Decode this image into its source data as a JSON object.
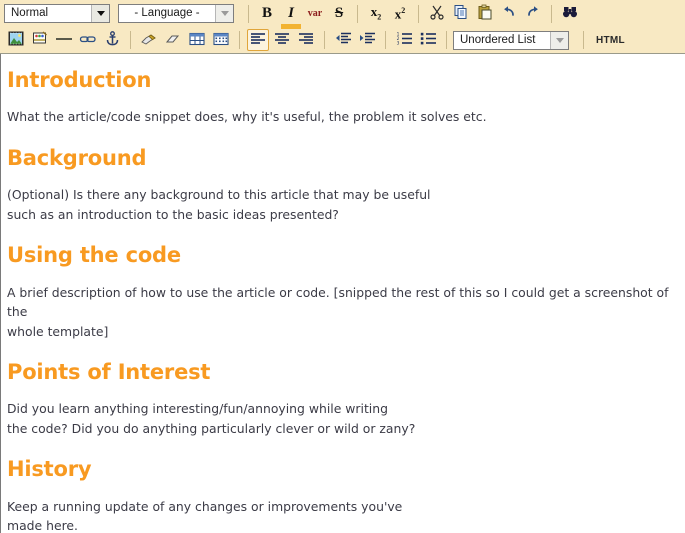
{
  "toolbar": {
    "row1": {
      "format_select": {
        "name": "paragraph-format-select",
        "value": "Normal",
        "enabled": true
      },
      "language_select": {
        "name": "language-select",
        "value": "- Language -",
        "enabled": false
      },
      "buttons": [
        {
          "name": "bold-button",
          "label": "B",
          "style": "lbl-b",
          "active": false
        },
        {
          "name": "italic-button",
          "label": "I",
          "style": "lbl-i",
          "active": true
        },
        {
          "name": "variable-button",
          "label": "var",
          "style": "lbl-var",
          "active": false
        },
        {
          "name": "strikethrough-button",
          "label": "S",
          "style": "lbl-s",
          "active": false
        }
      ],
      "script_buttons": [
        {
          "name": "subscript-button",
          "label": "x",
          "script": "2"
        },
        {
          "name": "superscript-button",
          "label": "x",
          "script": "2"
        }
      ],
      "clipboard_buttons": [
        {
          "name": "cut-icon",
          "label": "Cut"
        },
        {
          "name": "copy-icon",
          "label": "Copy"
        },
        {
          "name": "paste-icon",
          "label": "Paste"
        },
        {
          "name": "undo-icon",
          "label": "Undo"
        },
        {
          "name": "redo-icon",
          "label": "Redo"
        }
      ],
      "find_button": {
        "name": "find-icon",
        "label": "Find"
      }
    },
    "row2": {
      "insert_buttons": [
        {
          "name": "image-icon",
          "label": "Image"
        },
        {
          "name": "flash-icon",
          "label": "Flash"
        },
        {
          "name": "horizontal-rule-icon",
          "label": "Horizontal Rule"
        },
        {
          "name": "link-icon",
          "label": "Link"
        },
        {
          "name": "anchor-icon",
          "label": "Anchor"
        }
      ],
      "format_buttons": [
        {
          "name": "highlight-icon",
          "label": "Highlight"
        },
        {
          "name": "eraser-icon",
          "label": "Remove Format"
        },
        {
          "name": "table-icon",
          "label": "Table"
        },
        {
          "name": "table-properties-icon",
          "label": "Table Properties"
        }
      ],
      "align_buttons": [
        {
          "name": "align-left-button",
          "label": "Align Left",
          "active": true
        },
        {
          "name": "align-center-button",
          "label": "Align Center",
          "active": false
        },
        {
          "name": "align-right-button",
          "label": "Align Right",
          "active": false
        }
      ],
      "indent_buttons": [
        {
          "name": "outdent-button",
          "label": "Decrease Indent"
        },
        {
          "name": "indent-button",
          "label": "Increase Indent"
        }
      ],
      "list_buttons": [
        {
          "name": "numbered-list-button",
          "label": "Numbered List"
        },
        {
          "name": "bulleted-list-button",
          "label": "Bulleted List"
        }
      ],
      "list_style_select": {
        "name": "list-style-select",
        "value": "Unordered List",
        "enabled": true
      },
      "html_button": {
        "name": "html-source-button",
        "label": "HTML"
      }
    }
  },
  "document": {
    "sections": [
      {
        "heading": "Introduction",
        "lines": [
          "What the article/code snippet does, why it's useful, the problem it solves etc."
        ]
      },
      {
        "heading": "Background",
        "lines": [
          "(Optional) Is there any background to this article that may be useful",
          "such as an introduction to the basic ideas presented?"
        ]
      },
      {
        "heading": "Using the code",
        "lines": [
          "A brief description of how to use the article or code.  [snipped the rest of this so I could get a screenshot of the",
          "whole template]"
        ]
      },
      {
        "heading": "Points of Interest",
        "lines": [
          "Did you learn anything interesting/fun/annoying while writing",
          "the code? Did you do anything particularly clever or wild or zany?"
        ]
      },
      {
        "heading": "History",
        "lines": [
          "Keep a running update of any changes or improvements you've",
          "made here."
        ]
      }
    ]
  },
  "colors": {
    "toolbar_background": "#f8e9c3",
    "heading": "#f89a21",
    "body_text": "#3b3b46",
    "active_highlight": "#f2b332",
    "variable_text": "#8d1c1c"
  }
}
